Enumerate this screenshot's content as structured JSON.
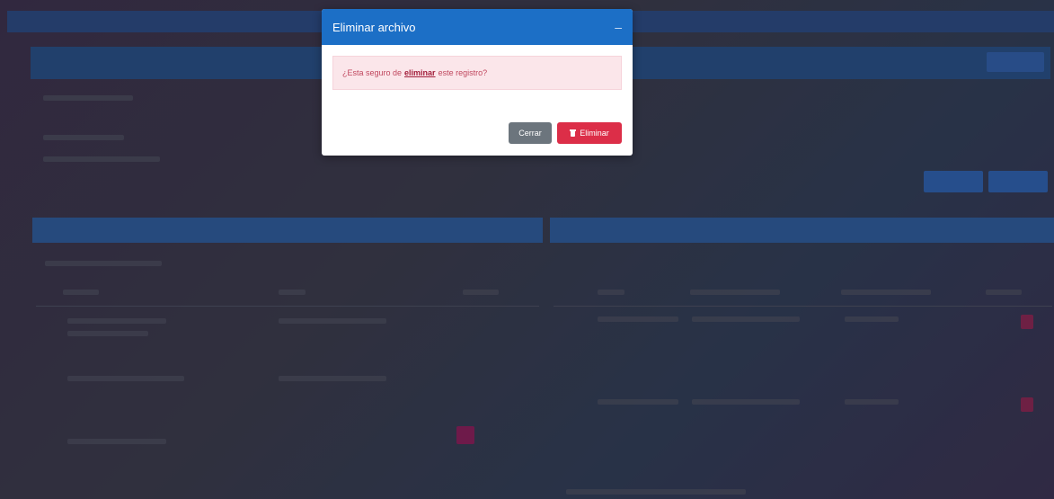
{
  "modal": {
    "title": "Eliminar archivo",
    "close_icon": "close-icon",
    "message_before": "¿Esta seguro de",
    "message_emphasis": "eliminar",
    "message_after": "este registro?",
    "cancel_label": "Cerrar",
    "delete_label": "Eliminar",
    "delete_icon": "trash-icon"
  },
  "colors": {
    "header": "#1c6fc6",
    "alert_bg": "#fbe6ea",
    "alert_text": "#c0475e",
    "cancel_button": "#6c757d",
    "delete_button": "#dc2e48"
  }
}
